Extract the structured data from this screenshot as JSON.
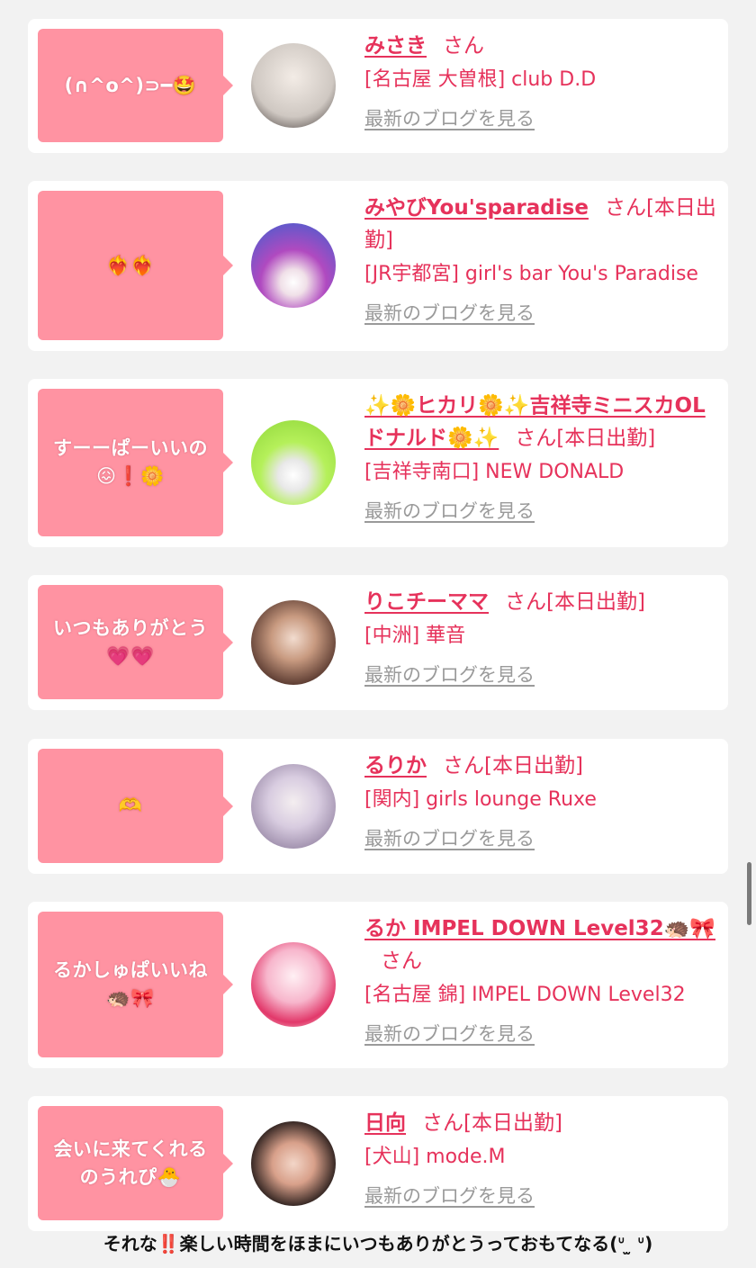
{
  "entries": [
    {
      "message": "(∩^o^)⊃━🤩",
      "name": "みさき",
      "san": "さん",
      "status": "",
      "shop": "[名古屋 大曽根] club D.D",
      "blog": "最新のブログを見る",
      "avatar_color": "#d8d4d0"
    },
    {
      "message": "❤️‍🔥❤️‍🔥",
      "name": "みやびYou'sparadise",
      "san": "さん",
      "status": "[本日出勤]",
      "shop": "[JR宇都宮] girl's bar You's Paradise",
      "blog": "最新のブログを見る",
      "avatar_color": "#7a3fb0"
    },
    {
      "message": "すーーぱーいいの😖❗🌼",
      "name": "✨🌼ヒカリ🌼✨吉祥寺ミニスカOLドナルド🌼✨",
      "san": "さん",
      "status": "[本日出勤]",
      "shop": "[吉祥寺南口] NEW DONALD",
      "blog": "最新のブログを見る",
      "avatar_color": "#b5f05a"
    },
    {
      "message": "いつもありがとう💗💗",
      "name": "りこチーママ",
      "san": "さん",
      "status": "[本日出勤]",
      "shop": "[中洲] 華音",
      "blog": "最新のブログを見る",
      "avatar_color": "#5a3a30"
    },
    {
      "message": "🫶",
      "name": "るりか",
      "san": "さん",
      "status": "[本日出勤]",
      "shop": "[関内] girls lounge Ruxe",
      "blog": "最新のブログを見る",
      "avatar_color": "#b9a8c8"
    },
    {
      "message": "るかしゅぱいいね🦔🎀",
      "name": "るか IMPEL DOWN Level32🦔🎀",
      "san": "さん",
      "status": "",
      "shop": "[名古屋 錦] IMPEL DOWN Level32",
      "blog": "最新のブログを見る",
      "avatar_color": "#e8e0dc"
    },
    {
      "message": "会いに来てくれるのうれぴ🐣",
      "name": "日向",
      "san": "さん",
      "status": "[本日出勤]",
      "shop": "[犬山] mode.M",
      "blog": "最新のブログを見る",
      "avatar_color": "#2a2220"
    }
  ],
  "footer": {
    "before": "それな",
    "exclaim": "‼️",
    "after": "楽しい時間をほまにいつもありがとうっておもてなる(ᐡ ̫ ᐡ)"
  },
  "colors": {
    "accent": "#e6325b",
    "bubble": "#ff93a2",
    "link_gray": "#9a9a9a"
  }
}
